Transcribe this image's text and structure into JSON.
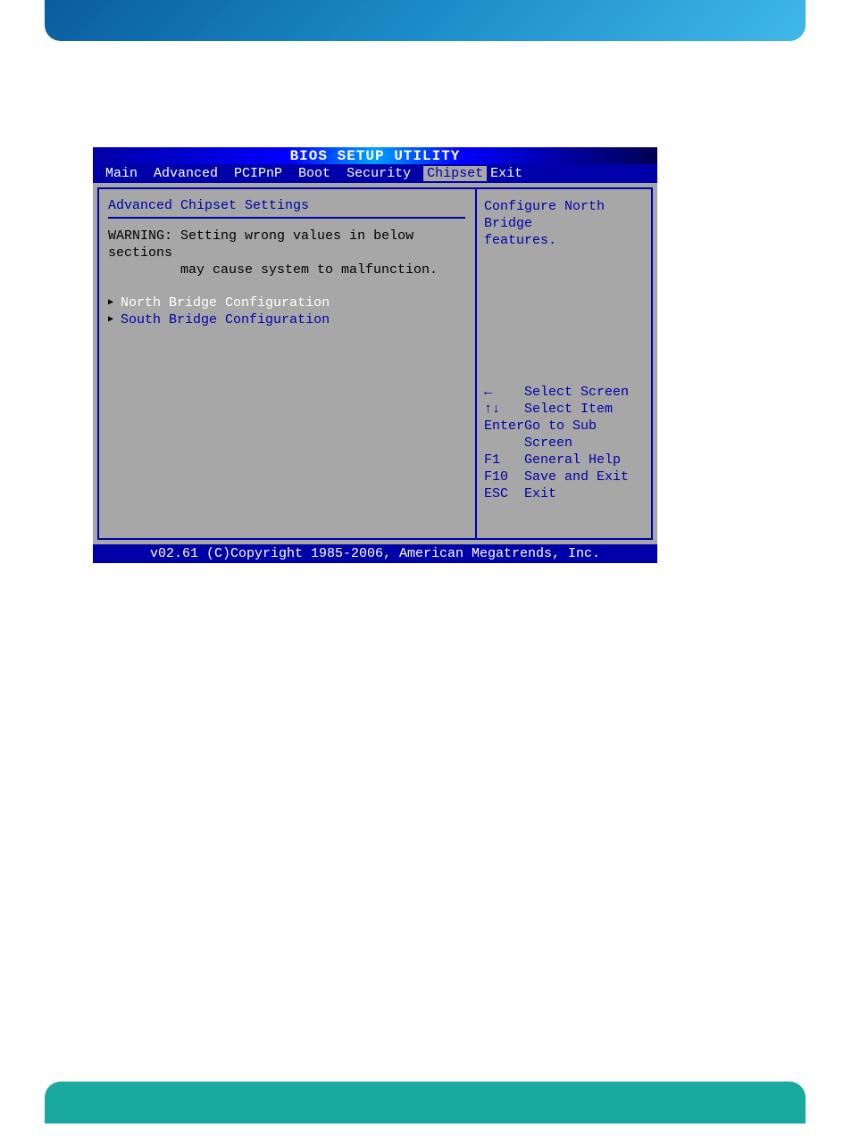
{
  "bios": {
    "title": "BIOS SETUP UTILITY",
    "menu": {
      "items": [
        "Main",
        "Advanced",
        "PCIPnP",
        "Boot",
        "Security",
        "Chipset",
        "Exit"
      ],
      "active_index": 5
    },
    "left": {
      "heading": "Advanced Chipset Settings",
      "warning_label": "WARNING:",
      "warning_line1": "Setting wrong values in below sections",
      "warning_line2": "may cause system to malfunction.",
      "options": [
        {
          "label": "North Bridge Configuration"
        },
        {
          "label": "South Bridge Configuration"
        }
      ]
    },
    "right": {
      "desc_line1": "Configure North Bridge",
      "desc_line2": "features.",
      "keys": [
        {
          "k": "←    ",
          "v": "Select Screen"
        },
        {
          "k": "↑↓   ",
          "v": "Select Item"
        },
        {
          "k": "Enter",
          "v": "Go to Sub Screen"
        },
        {
          "k": "F1   ",
          "v": "General Help"
        },
        {
          "k": "F10  ",
          "v": "Save and Exit"
        },
        {
          "k": "ESC  ",
          "v": "Exit"
        }
      ]
    },
    "footer": "v02.61 (C)Copyright 1985-2006, American Megatrends, Inc."
  }
}
